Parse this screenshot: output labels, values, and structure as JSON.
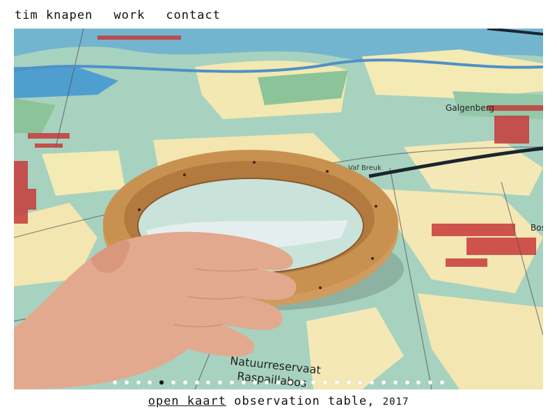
{
  "nav": {
    "home": "tim knapen",
    "work": "work",
    "contact": "contact"
  },
  "slide": {
    "map_labels": {
      "reserve_line1": "Natuurreservaat",
      "reserve_line2": "Raspaillabos",
      "town": "Bos",
      "road": "Vaf Breuk",
      "district": "Galgenberg"
    }
  },
  "slideshow": {
    "total": 29,
    "active_index": 4
  },
  "caption": {
    "project_link": "open kaart",
    "description": "observation table,",
    "year": "2017"
  }
}
